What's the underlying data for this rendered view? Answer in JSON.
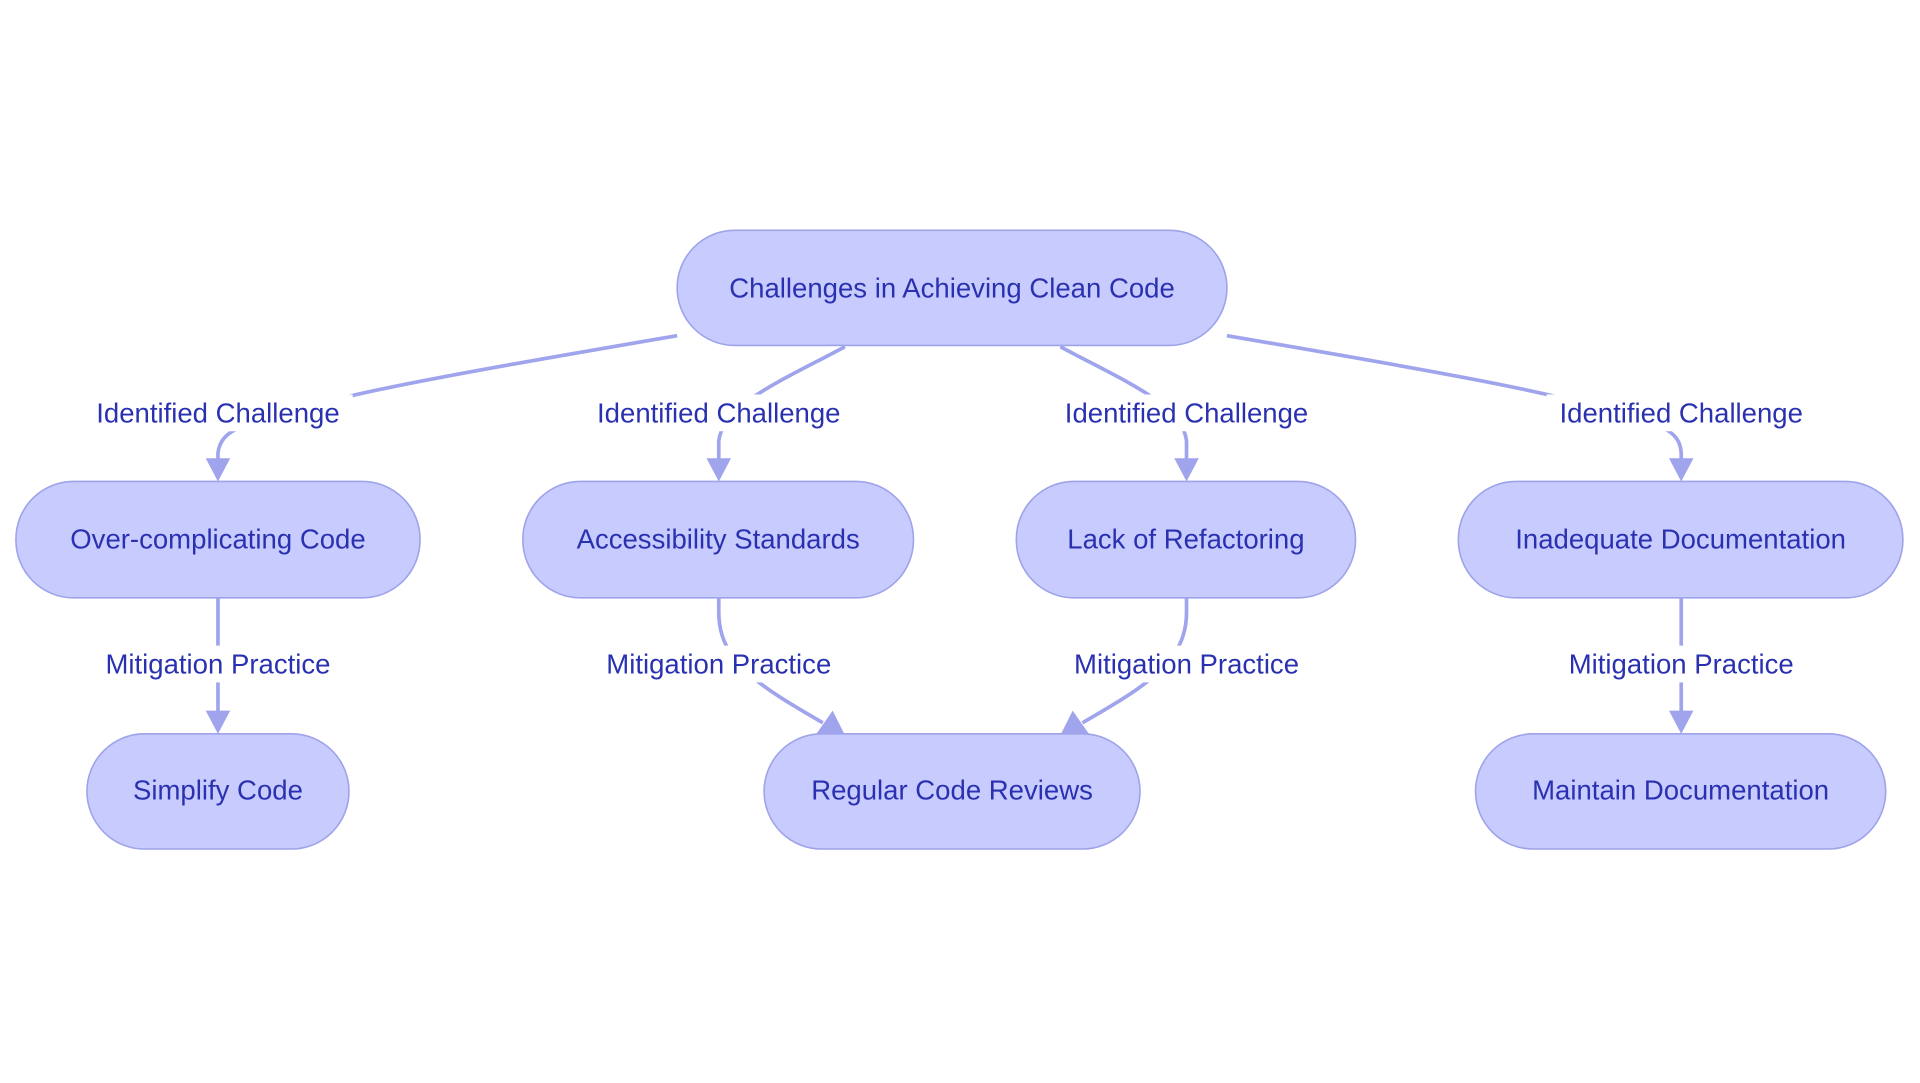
{
  "diagram": {
    "type": "flowchart",
    "colors": {
      "node_fill": "#c8cbfd",
      "node_stroke": "#9ea3ea",
      "text": "#2a31b0",
      "edge": "#9fa4ec"
    },
    "nodes": [
      {
        "id": "root",
        "label": "Challenges in Achieving Clean Code"
      },
      {
        "id": "overcomplicating",
        "label": "Over-complicating Code"
      },
      {
        "id": "accessibility",
        "label": "Accessibility Standards"
      },
      {
        "id": "refactoring",
        "label": "Lack of Refactoring"
      },
      {
        "id": "documentation",
        "label": "Inadequate Documentation"
      },
      {
        "id": "simplify",
        "label": "Simplify Code"
      },
      {
        "id": "reviews",
        "label": "Regular Code Reviews"
      },
      {
        "id": "maintain",
        "label": "Maintain Documentation"
      }
    ],
    "edges": [
      {
        "from": "root",
        "to": "overcomplicating",
        "label": "Identified Challenge"
      },
      {
        "from": "root",
        "to": "accessibility",
        "label": "Identified Challenge"
      },
      {
        "from": "root",
        "to": "refactoring",
        "label": "Identified Challenge"
      },
      {
        "from": "root",
        "to": "documentation",
        "label": "Identified Challenge"
      },
      {
        "from": "overcomplicating",
        "to": "simplify",
        "label": "Mitigation Practice"
      },
      {
        "from": "accessibility",
        "to": "reviews",
        "label": "Mitigation Practice"
      },
      {
        "from": "refactoring",
        "to": "reviews",
        "label": "Mitigation Practice"
      },
      {
        "from": "documentation",
        "to": "maintain",
        "label": "Mitigation Practice"
      }
    ]
  }
}
